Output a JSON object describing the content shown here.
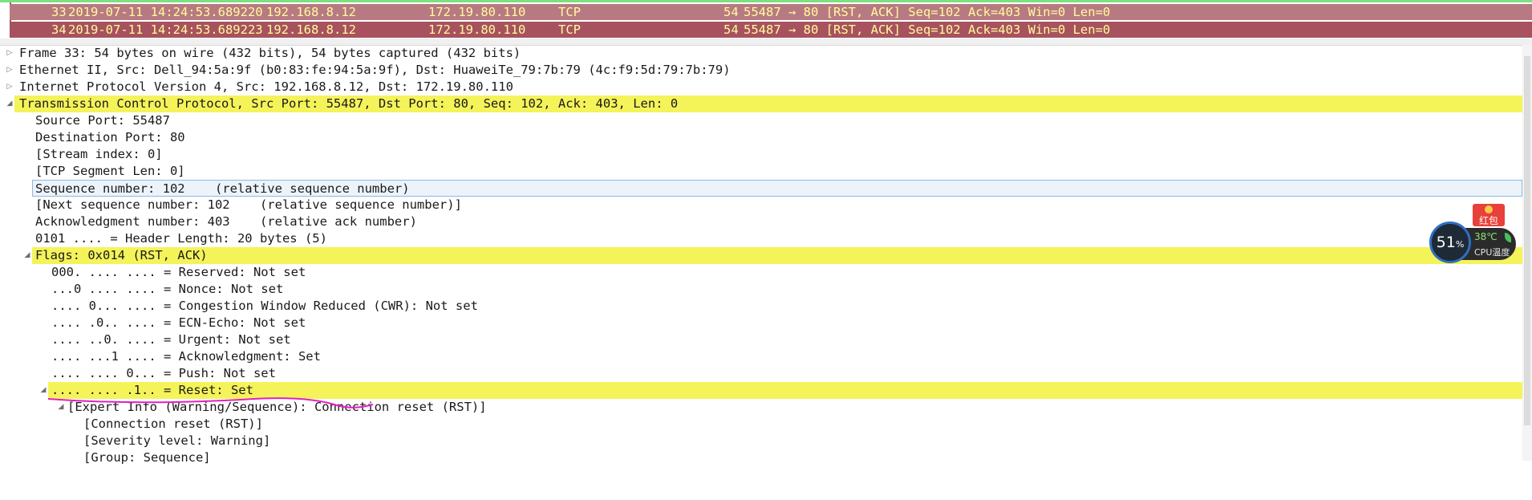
{
  "packet_list": [
    {
      "no": "33",
      "time": "2019-07-11 14:24:53.689220",
      "src": "192.168.8.12",
      "dst": "172.19.80.110",
      "proto": "TCP",
      "len": "54",
      "info": "55487 → 80 [RST, ACK] Seq=102 Ack=403 Win=0 Len=0"
    },
    {
      "no": "34",
      "time": "2019-07-11 14:24:53.689223",
      "src": "192.168.8.12",
      "dst": "172.19.80.110",
      "proto": "TCP",
      "len": "54",
      "info": "55487 → 80 [RST, ACK] Seq=102 Ack=403 Win=0 Len=0"
    }
  ],
  "details": [
    {
      "text": "Frame 33: 54 bytes on wire (432 bits), 54 bytes captured (432 bits)",
      "expander": "▷"
    },
    {
      "text": "Ethernet II, Src: Dell_94:5a:9f (b0:83:fe:94:5a:9f), Dst: HuaweiTe_79:7b:79 (4c:f9:5d:79:7b:79)",
      "expander": "▷"
    },
    {
      "text": "Internet Protocol Version 4, Src: 192.168.8.12, Dst: 172.19.80.110",
      "expander": "▷"
    },
    {
      "text": "Transmission Control Protocol, Src Port: 55487, Dst Port: 80, Seq: 102, Ack: 403, Len: 0",
      "expander": "◢"
    },
    {
      "text": "Source Port: 55487"
    },
    {
      "text": "Destination Port: 80"
    },
    {
      "text": "[Stream index: 0]"
    },
    {
      "text": "[TCP Segment Len: 0]"
    },
    {
      "text": "Sequence number: 102    (relative sequence number)"
    },
    {
      "text": "[Next sequence number: 102    (relative sequence number)]"
    },
    {
      "text": "Acknowledgment number: 403    (relative ack number)"
    },
    {
      "text": "0101 .... = Header Length: 20 bytes (5)"
    },
    {
      "text": "Flags: 0x014 (RST, ACK)",
      "expander": "◢"
    },
    {
      "text": "000. .... .... = Reserved: Not set"
    },
    {
      "text": "...0 .... .... = Nonce: Not set"
    },
    {
      "text": ".... 0... .... = Congestion Window Reduced (CWR): Not set"
    },
    {
      "text": ".... .0.. .... = ECN-Echo: Not set"
    },
    {
      "text": ".... ..0. .... = Urgent: Not set"
    },
    {
      "text": ".... ...1 .... = Acknowledgment: Set"
    },
    {
      "text": ".... .... 0... = Push: Not set"
    },
    {
      "text": ".... .... .1.. = Reset: Set",
      "expander": "◢"
    },
    {
      "text": "[Expert Info (Warning/Sequence): Connection reset (RST)]",
      "expander": "◢"
    },
    {
      "text": "[Connection reset (RST)]"
    },
    {
      "text": "[Severity level: Warning]"
    },
    {
      "text": "[Group: Sequence]"
    }
  ],
  "widgets": {
    "hongbao_label": "红包",
    "cpu_value": "51",
    "cpu_percent_sign": "%",
    "cpu_temp": "38℃",
    "cpu_label": "CPU温度",
    "icons": [
      "coin-icon",
      "leaf-icon"
    ]
  },
  "colors": {
    "packet_row_fg": "#fffc9c",
    "packet_row_1_bg": "#b87a82",
    "packet_row_2_bg": "#a7525e",
    "highlight_yellow": "#f5f35a",
    "selection_border": "#8fb8e0",
    "annotation_underline": "#e020c8"
  }
}
